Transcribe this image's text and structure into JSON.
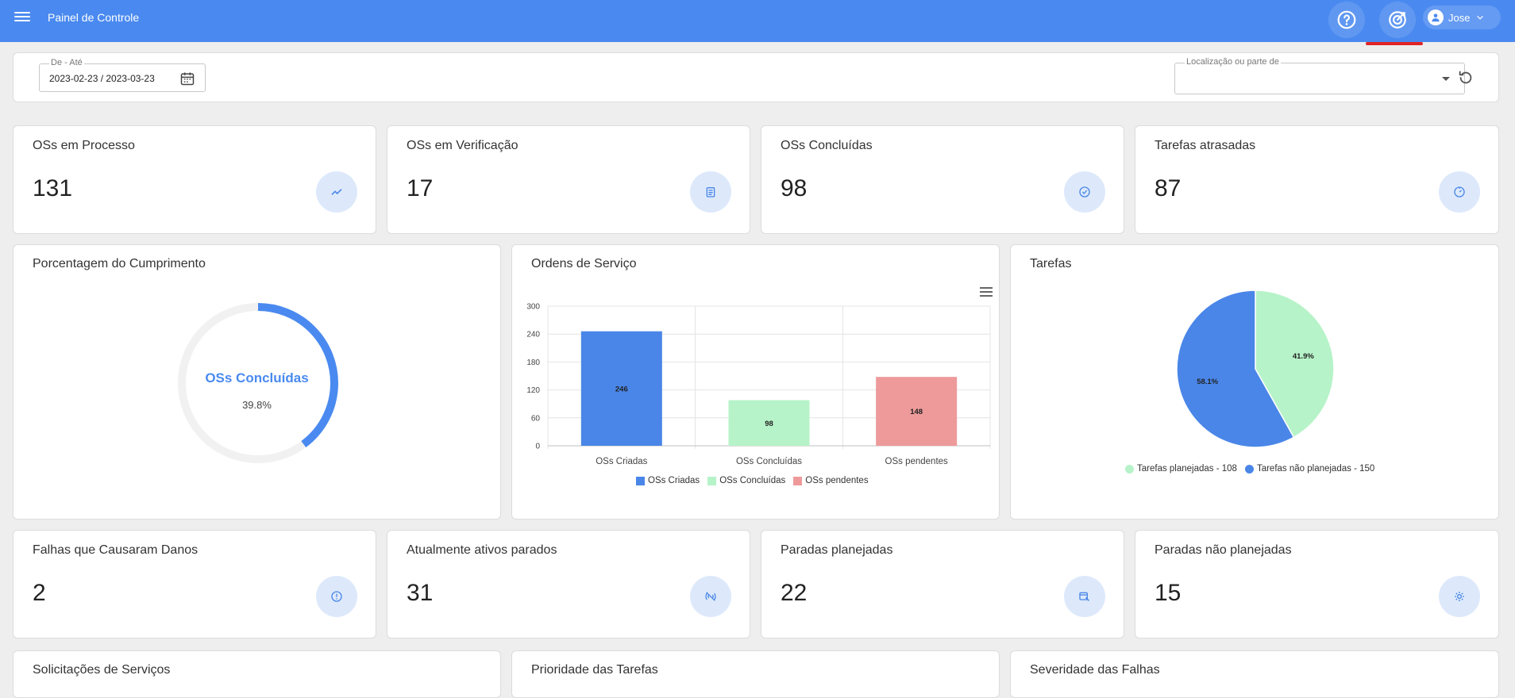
{
  "header": {
    "title": "Painel de Controle",
    "user_name": "Jose"
  },
  "filters": {
    "date_range": {
      "legend": "De - Até",
      "value": "2023-02-23 / 2023-03-23"
    },
    "location": {
      "legend": "Localização ou parte de",
      "value": ""
    }
  },
  "stats_top": [
    {
      "title": "OSs em Processo",
      "value": "131",
      "icon": "trending-up-icon"
    },
    {
      "title": "OSs em Verificação",
      "value": "17",
      "icon": "clipboard-icon"
    },
    {
      "title": "OSs Concluídas",
      "value": "98",
      "icon": "check-circle-icon"
    },
    {
      "title": "Tarefas atrasadas",
      "value": "87",
      "icon": "timer-icon"
    }
  ],
  "compliance": {
    "title": "Porcentagem do Cumprimento",
    "label": "OSs Concluídas",
    "percent_text": "39.8%",
    "percent": 39.8
  },
  "orders": {
    "title": "Ordens de Serviço"
  },
  "tasks": {
    "title": "Tarefas"
  },
  "stats_bottom": [
    {
      "title": "Falhas que Causaram Danos",
      "value": "2",
      "icon": "alert-circle-icon"
    },
    {
      "title": "Atualmente ativos parados",
      "value": "31",
      "icon": "signal-off-icon"
    },
    {
      "title": "Paradas planejadas",
      "value": "22",
      "icon": "calendar-wrench-icon"
    },
    {
      "title": "Paradas não planejadas",
      "value": "15",
      "icon": "gear-icon"
    }
  ],
  "bottom_panels": [
    {
      "title": "Solicitações de Serviços"
    },
    {
      "title": "Prioridade das Tarefas"
    },
    {
      "title": "Severidade das Falhas"
    }
  ],
  "colors": {
    "primary": "#4a8af0",
    "criadas": "#4a86e8",
    "concluidas": "#b6f3c8",
    "pendentes": "#ee9a9a",
    "alert": "#e02424"
  },
  "chart_data": [
    {
      "type": "bar",
      "categories": [
        "OSs Criadas",
        "OSs Concluídas",
        "OSs pendentes"
      ],
      "values": [
        246,
        98,
        148
      ],
      "data_labels": [
        "246",
        "98",
        "148"
      ],
      "colors": [
        "#4a86e8",
        "#b6f3c8",
        "#ee9a9a"
      ],
      "ylim": [
        0,
        300
      ],
      "yticks": [
        0,
        60,
        120,
        180,
        240,
        300
      ],
      "legend": [
        "OSs Criadas",
        "OSs Concluídas",
        "OSs pendentes"
      ],
      "legend_position": "bottom",
      "grid": true
    },
    {
      "type": "pie",
      "slices": [
        {
          "label": "Tarefas planejadas - 108",
          "value": 108,
          "percent_text": "41.9%",
          "color": "#b6f3c8"
        },
        {
          "label": "Tarefas não planejadas - 150",
          "value": 150,
          "percent_text": "58.1%",
          "color": "#4a86e8"
        }
      ],
      "legend_position": "bottom"
    }
  ]
}
